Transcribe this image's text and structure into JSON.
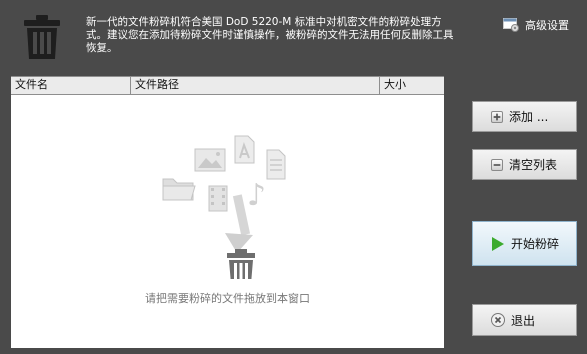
{
  "header": {
    "description": "新一代的文件粉碎机符合美国 DoD 5220-M 标准中对机密文件的粉碎处理方式。建议您在添加待粉碎文件时谨慎操作，被粉碎的文件无法用任何反删除工具恢复。",
    "advanced_label": "高级设置"
  },
  "table": {
    "columns": [
      "文件名",
      "文件路径",
      "大小"
    ]
  },
  "dropzone": {
    "hint": "请把需要粉碎的文件拖放到本窗口"
  },
  "buttons": {
    "add": "添加 ...",
    "clear": "清空列表",
    "start": "开始粉碎",
    "exit": "退出"
  },
  "colors": {
    "background": "#4a4a4a",
    "list_background": "#ffffff",
    "start_button": "#cfe3ef",
    "start_arrow": "#3cab2e"
  }
}
